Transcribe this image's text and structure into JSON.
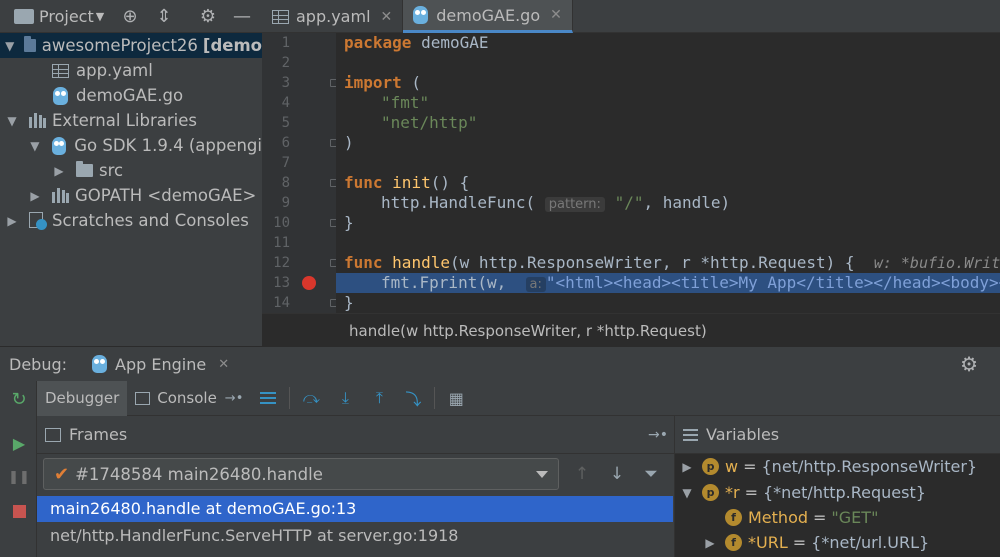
{
  "project_panel": {
    "title": "Project",
    "tree": [
      {
        "label": "awesomeProject26",
        "suffix": "[demo",
        "icon": "folder-icon"
      },
      {
        "label": "app.yaml",
        "icon": "yaml-file-icon"
      },
      {
        "label": "demoGAE.go",
        "icon": "go-file-icon"
      },
      {
        "label": "External Libraries",
        "icon": "library-icon"
      },
      {
        "label": "Go SDK 1.9.4 (appengi",
        "icon": "go-sdk-icon"
      },
      {
        "label": "src",
        "icon": "folder-icon"
      },
      {
        "label": "GOPATH <demoGAE>",
        "icon": "library-icon"
      },
      {
        "label": "Scratches and Consoles",
        "icon": "scratches-icon"
      }
    ]
  },
  "editor": {
    "tabs": [
      {
        "label": "app.yaml",
        "active": false
      },
      {
        "label": "demoGAE.go",
        "active": true
      }
    ],
    "line_numbers": [
      "1",
      "2",
      "3",
      "4",
      "5",
      "6",
      "7",
      "8",
      "9",
      "10",
      "11",
      "12",
      "13",
      "14"
    ],
    "code": {
      "l1_kw": "package",
      "l1_rest": " demoGAE",
      "l3_kw": "import",
      "l3_rest": " (",
      "l4_str": "\"fmt\"",
      "l5_str": "\"net/http\"",
      "l6": ")",
      "l8_kw": "func",
      "l8_fn": "init",
      "l8_rest": "() {",
      "l9_call": "http.HandleFunc(",
      "l9_hint": "pattern:",
      "l9_str": "\"/\"",
      "l9_rest": ", handle)",
      "l10": "}",
      "l12_kw": "func",
      "l12_fn": "handle",
      "l12_rest": "(w http.ResponseWriter, r *http.Request) {",
      "l12_inline": "w: *bufio.Writer",
      "l13_call": "fmt.Fprint(w,",
      "l13_hint": "a:",
      "l13_str": "\"<html><head><title>My App</title></head><body><h",
      "l14": "}"
    },
    "breadcrumb": "handle(w http.ResponseWriter, r *http.Request)"
  },
  "debug": {
    "label": "Debug:",
    "config_tab": "App Engine",
    "subtabs": [
      {
        "label": "Debugger",
        "active": true
      },
      {
        "label": "Console",
        "active": false
      }
    ],
    "frames": {
      "title": "Frames",
      "thread": "#1748584 main26480.handle",
      "rows": [
        {
          "label": "main26480.handle at demoGAE.go:13",
          "selected": true
        },
        {
          "label": "net/http.HandlerFunc.ServeHTTP at server.go:1918",
          "selected": false
        }
      ]
    },
    "variables": {
      "title": "Variables",
      "rows": [
        {
          "badge": "p",
          "name": "w",
          "value": "{net/http.ResponseWriter}"
        },
        {
          "badge": "p",
          "name": "*r",
          "value": "{*net/http.Request}"
        },
        {
          "badge": "f",
          "name": "Method",
          "value": "\"GET\""
        },
        {
          "badge": "f",
          "name": "*URL",
          "value": "{*net/url.URL}"
        }
      ]
    }
  },
  "colors": {
    "selection": "#2f65ca",
    "exec_line": "#2d5081",
    "keyword": "#cc7832",
    "string": "#6a8759",
    "function": "#ffc66d",
    "breakpoint": "#d9372c"
  }
}
